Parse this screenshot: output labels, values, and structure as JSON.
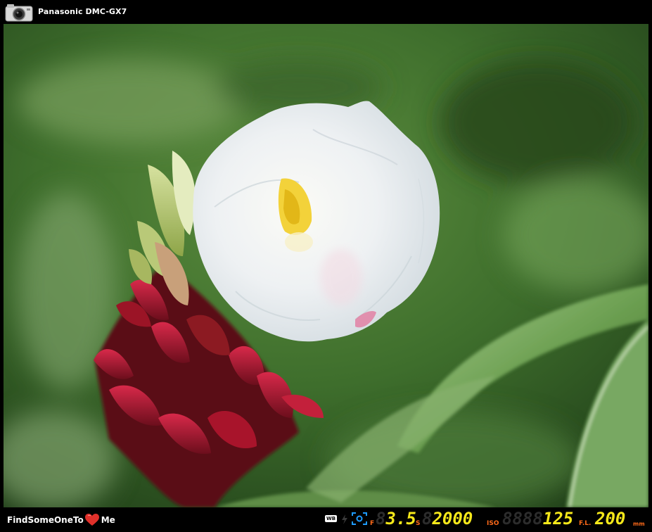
{
  "header": {
    "camera_model": "Panasonic DMC-GX7",
    "camera_icon": "camera-icon"
  },
  "footer": {
    "brand_prefix": "FindSomeOneTo",
    "brand_suffix": "Me",
    "heart_icon": "heart-icon",
    "exif": {
      "wb_label": "WB",
      "flash_icon": "flash-icon",
      "metering_icon": "metering-icon",
      "aperture_label": "F",
      "aperture_ghost": "8",
      "aperture_value": "3.5",
      "shutter_label": "S",
      "shutter_ghost": "8",
      "shutter_value": "2000",
      "iso_label": "ISO",
      "iso_ghost": "8888",
      "iso_value": "125",
      "focal_label": "F.L.",
      "focal_value": "200",
      "focal_unit": "mm"
    }
  },
  "colors": {
    "background": "#000000",
    "label_orange": "#ff6a1a",
    "digit_yellow": "#f6e81a",
    "digit_ghost": "#2c2c2c",
    "leaf_green": "#3f7a2c",
    "petal_white": "#f1f3f5",
    "bract_red": "#b5172c"
  },
  "photo": {
    "subject": ""
  }
}
